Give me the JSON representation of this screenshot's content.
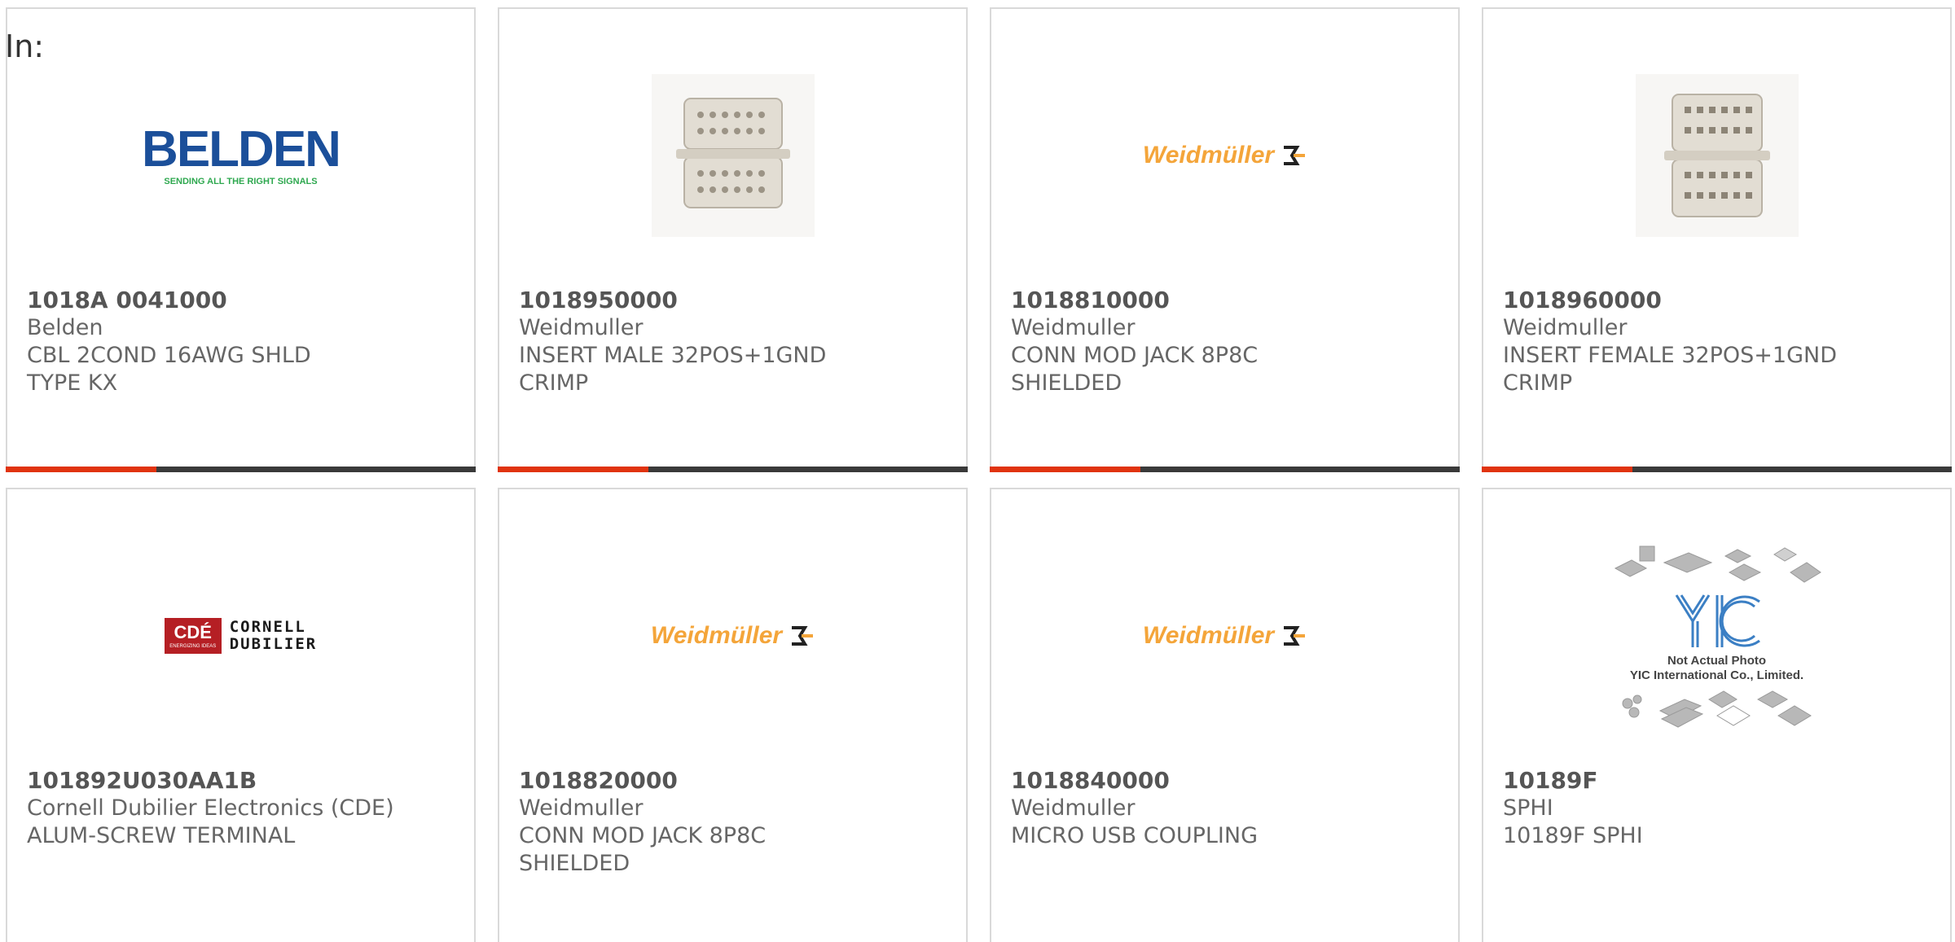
{
  "header": {
    "label": "In:"
  },
  "colors": {
    "bar_accent": "#e0330f",
    "bar_dark": "#3a3a3a",
    "card_border": "#d9d9d9",
    "text": "#666666"
  },
  "products": [
    {
      "part_number": "1018A 0041000",
      "manufacturer": "Belden",
      "description": "CBL 2COND 16AWG SHLD TYPE KX",
      "image": "belden-logo",
      "logo_text": "BELDEN",
      "logo_tagline": "SENDING ALL THE RIGHT SIGNALS"
    },
    {
      "part_number": "1018950000",
      "manufacturer": "Weidmuller",
      "description": "INSERT MALE 32POS+1GND CRIMP",
      "image": "connector-insert-photo"
    },
    {
      "part_number": "1018810000",
      "manufacturer": "Weidmuller",
      "description": "CONN MOD JACK 8P8C SHIELDED",
      "image": "weidmuller-logo",
      "logo_text": "Weidmüller"
    },
    {
      "part_number": "1018960000",
      "manufacturer": "Weidmuller",
      "description": "INSERT FEMALE 32POS+1GND CRIMP",
      "image": "connector-insert-photo"
    },
    {
      "part_number": "101892U030AA1B",
      "manufacturer": "Cornell Dubilier Electronics (CDE)",
      "description": "ALUM-SCREW TERMINAL",
      "image": "cde-logo",
      "logo_text": "CDÉ",
      "logo_name_line1": "CORNELL",
      "logo_name_line2": "DUBILIER",
      "logo_tagline": "ENERGIZING IDEAS"
    },
    {
      "part_number": "1018820000",
      "manufacturer": "Weidmuller",
      "description": "CONN MOD JACK 8P8C SHIELDED",
      "image": "weidmuller-logo",
      "logo_text": "Weidmüller"
    },
    {
      "part_number": "1018840000",
      "manufacturer": "Weidmuller",
      "description": "MICRO USB COUPLING",
      "image": "weidmuller-logo",
      "logo_text": "Weidmüller"
    },
    {
      "part_number": "10189F",
      "manufacturer": "SPHI",
      "description": "10189F SPHI",
      "image": "not-actual-photo-placeholder",
      "placeholder_line1": "Not Actual Photo",
      "placeholder_line2": "YIC International Co., Limited."
    }
  ]
}
